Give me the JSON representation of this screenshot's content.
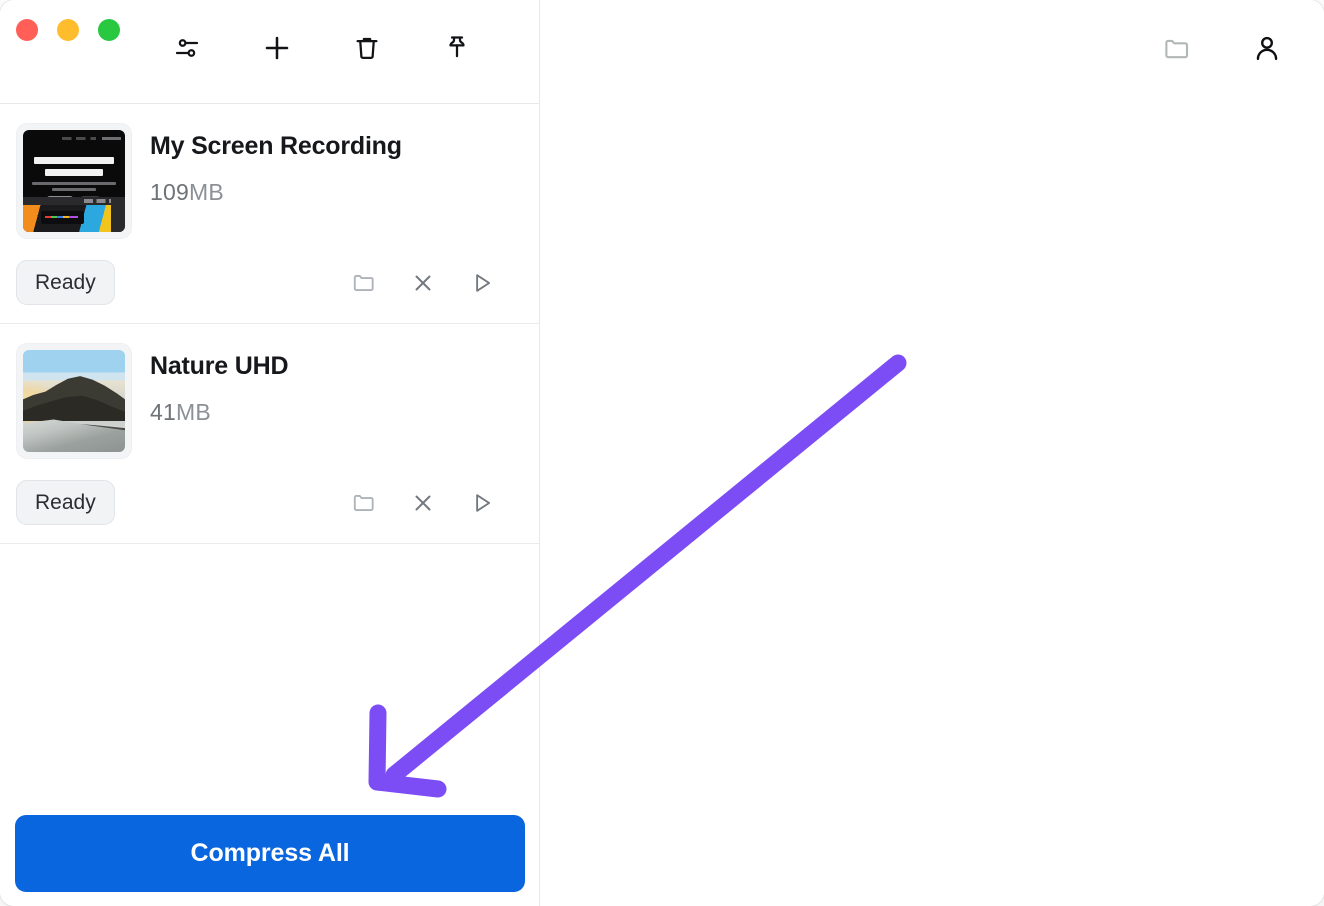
{
  "window": {
    "traffic_lights": [
      {
        "name": "close",
        "color": "#ff5f57"
      },
      {
        "name": "minimize",
        "color": "#ffbd2e"
      },
      {
        "name": "maximize",
        "color": "#28c840"
      }
    ]
  },
  "toolbar": {
    "items": [
      {
        "icon": "settings-sliders-icon",
        "label": "Settings"
      },
      {
        "icon": "plus-icon",
        "label": "Add"
      },
      {
        "icon": "trash-icon",
        "label": "Delete"
      },
      {
        "icon": "pin-icon",
        "label": "Pin"
      }
    ]
  },
  "right_toolbar": {
    "items": [
      {
        "icon": "folder-icon",
        "label": "Open Folder"
      },
      {
        "icon": "user-icon",
        "label": "Account"
      }
    ]
  },
  "file_list": {
    "items": [
      {
        "title": "My Screen Recording",
        "size_number": "109",
        "size_unit": "MB",
        "status": "Ready",
        "thumbnail": "screen-recording-thumbnail",
        "actions": [
          {
            "icon": "folder-icon",
            "label": "Reveal in Folder"
          },
          {
            "icon": "close-icon",
            "label": "Remove"
          },
          {
            "icon": "play-icon",
            "label": "Play"
          }
        ]
      },
      {
        "title": "Nature UHD",
        "size_number": "41",
        "size_unit": "MB",
        "status": "Ready",
        "thumbnail": "nature-photo-thumbnail",
        "actions": [
          {
            "icon": "folder-icon",
            "label": "Reveal in Folder"
          },
          {
            "icon": "close-icon",
            "label": "Remove"
          },
          {
            "icon": "play-icon",
            "label": "Play"
          }
        ]
      }
    ]
  },
  "footer": {
    "compress_label": "Compress All",
    "compress_color": "#0a66df"
  },
  "annotation": {
    "type": "arrow",
    "color": "#7c4df5",
    "points_to": "compress-all-button"
  }
}
